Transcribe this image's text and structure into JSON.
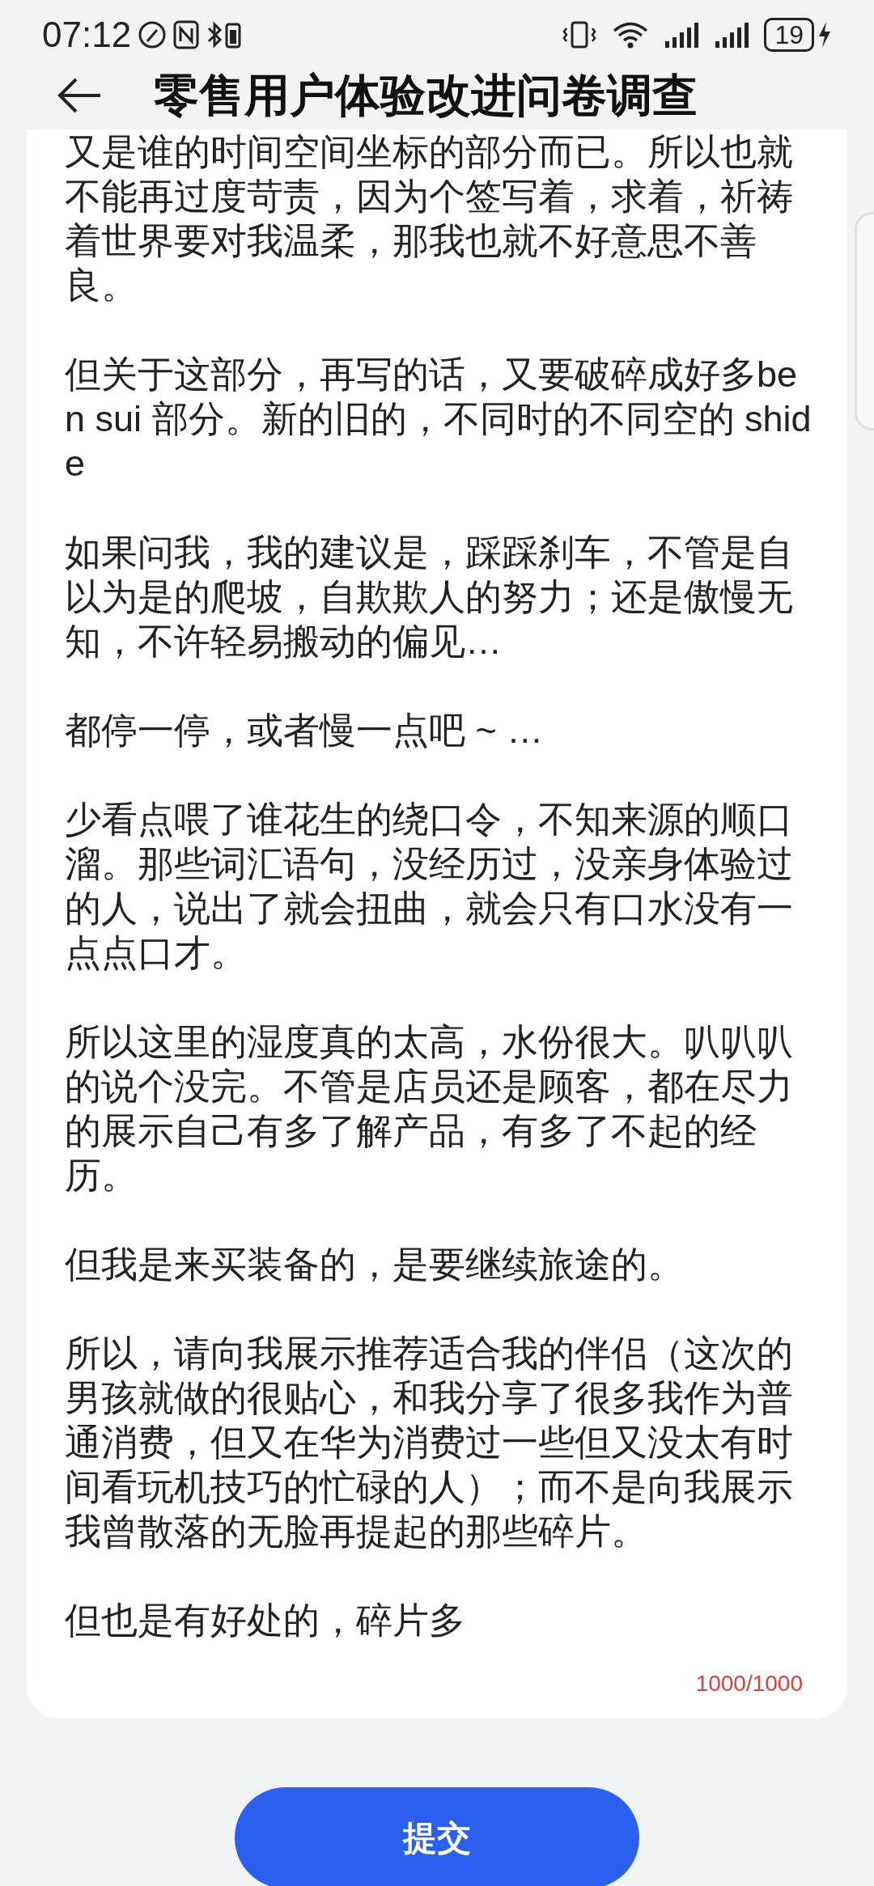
{
  "status_bar": {
    "time": "07:12",
    "battery": "19"
  },
  "header": {
    "title": "零售用户体验改进问卷调查"
  },
  "answer": {
    "paragraphs": [
      "又是谁的时间空间坐标的部分而已。所以也就不能再过度苛责，因为个签写着，求着，祈祷着世界要对我温柔，那我也就不好意思不善良。",
      "但关于这部分，再写的话，又要破碎成好多ben sui 部分。新的旧的，不同时的不同空的 shide",
      "如果问我，我的建议是，踩踩刹车，不管是自以为是的爬坡，自欺欺人的努力；还是傲慢无知，不许轻易搬动的偏见…",
      "都停一停，或者慢一点吧 ~ …",
      "少看点喂了谁花生的绕口令，不知来源的顺口溜。那些词汇语句，没经历过，没亲身体验过的人，说出了就会扭曲，就会只有口水没有一点点口才。",
      "所以这里的湿度真的太高，水份很大。叭叭叭的说个没完。不管是店员还是顾客，都在尽力的展示自己有多了解产品，有多了不起的经历。",
      "但我是来买装备的，是要继续旅途的。",
      "所以，请向我展示推荐适合我的伴侣（这次的男孩就做的很贴心，和我分享了很多我作为普通消费，但又在华为消费过一些但又没太有时间看玩机技巧的忙碌的人）；而不是向我展示我曾散落的无脸再提起的那些碎片。",
      "但也是有好处的，碎片多"
    ],
    "char_count": "1000/1000"
  },
  "submit_button": {
    "label": "提交"
  }
}
